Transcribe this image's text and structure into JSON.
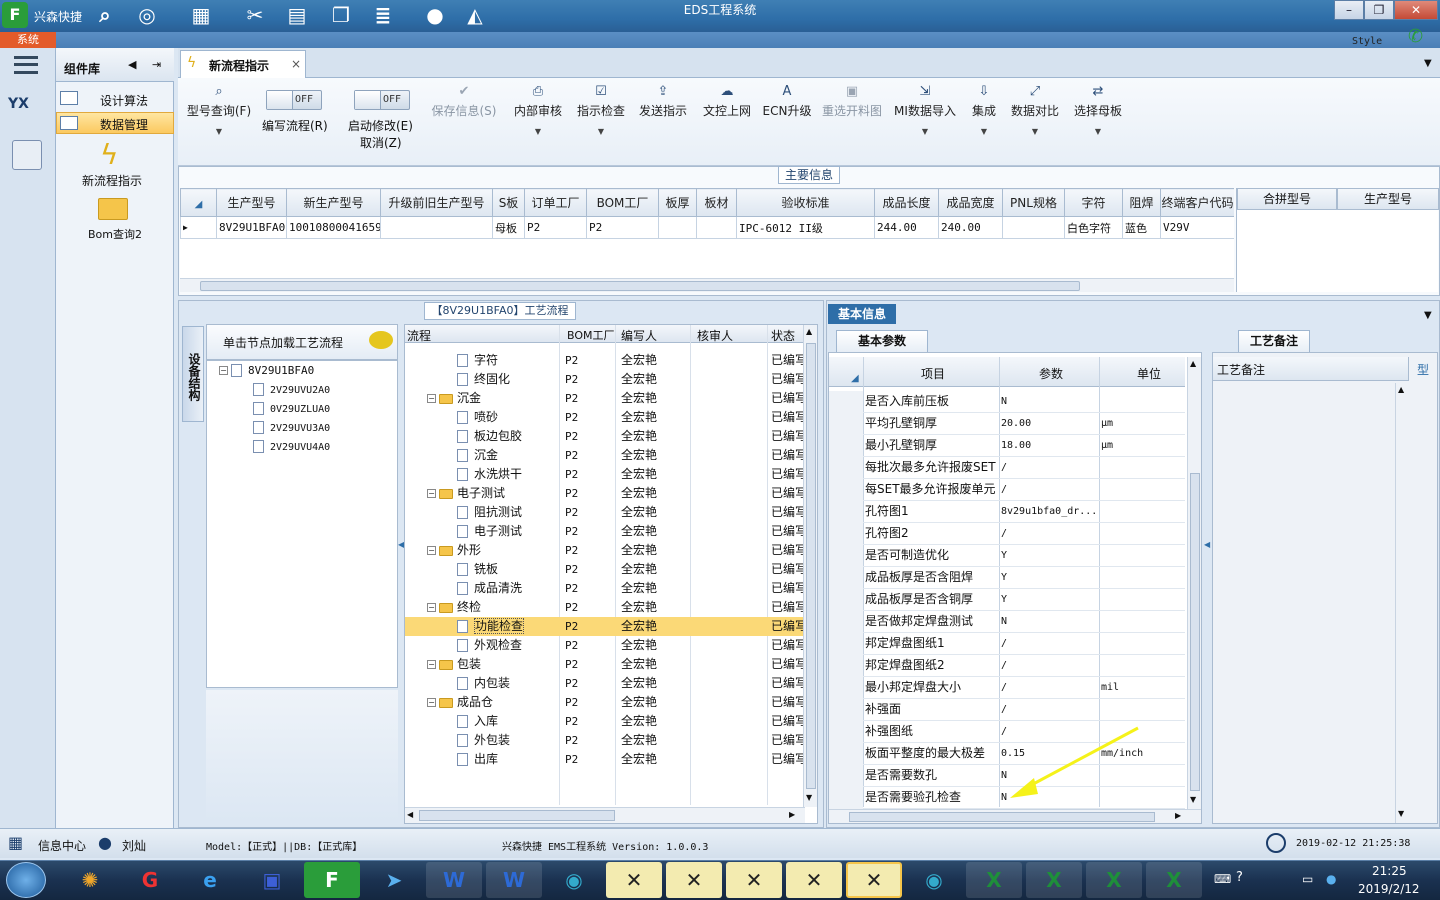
{
  "window": {
    "app_name": "兴森快捷",
    "title": "EDS工程系统",
    "menu_badge": "系统",
    "style_label": "Style",
    "min_label": "–",
    "max_label": "❐",
    "close_label": "✕"
  },
  "top_toolbar_icons": [
    "search-icon",
    "globe-icon",
    "table-icon",
    "scissors-icon",
    "film-icon",
    "clipboard-icon",
    "list-icon",
    "user-icon",
    "chart-icon"
  ],
  "left_nav": {
    "item1": "YX"
  },
  "component_panel": {
    "title": "组件库",
    "items": [
      {
        "label": "设计算法"
      },
      {
        "label": "数据管理"
      }
    ],
    "shortcuts": [
      {
        "label": "新流程指示"
      },
      {
        "label": "Bom查询2"
      }
    ]
  },
  "tab": {
    "label": "新流程指示",
    "close": "×"
  },
  "toolbar": {
    "buttons": [
      {
        "label": "型号查询(F)",
        "icon": "search-icon"
      },
      {
        "label": "保存信息(S)",
        "icon": "check-icon"
      },
      {
        "label": "内部审核",
        "icon": "print-icon"
      },
      {
        "label": "指示检查",
        "icon": "check-icon"
      },
      {
        "label": "发送指示",
        "icon": "upload-icon"
      },
      {
        "label": "文控上网",
        "icon": "cloud-upload-icon"
      },
      {
        "label": "ECN升级",
        "icon": "a-icon"
      },
      {
        "label": "重选开料图",
        "icon": "image-icon"
      },
      {
        "label": "MI数据导入",
        "icon": "import-icon"
      },
      {
        "label": "集成",
        "icon": "download-icon"
      },
      {
        "label": "数据对比",
        "icon": "compare-icon"
      },
      {
        "label": "选择母板",
        "icon": "shuffle-icon"
      }
    ],
    "toggle1": {
      "state": "OFF",
      "label": "编写流程(R)"
    },
    "toggle2": {
      "state": "OFF",
      "label": "启动修改(E)",
      "label2": "取消(Z)"
    }
  },
  "main_info": {
    "title": "主要信息",
    "columns": [
      "生产型号",
      "新生产型号",
      "升级前旧生产型号",
      "S板",
      "订单工厂",
      "BOM工厂",
      "板厚",
      "板材",
      "验收标准",
      "成品长度",
      "成品宽度",
      "PNL规格",
      "字符",
      "阻焊",
      "终端客户代码"
    ],
    "row": [
      "8V29U1BFA0",
      "10010800041659",
      "",
      "母板",
      "P2",
      "P2",
      "",
      "",
      "IPC-6012 II级",
      "244.00",
      "240.00",
      "",
      "白色字符",
      "蓝色",
      "V29V"
    ],
    "side_columns": [
      "合拼型号",
      "生产型号"
    ]
  },
  "process": {
    "title": "【8V29U1BFA0】工艺流程",
    "side_tab": "设备结构",
    "hint": "单击节点加载工艺流程",
    "tree": [
      {
        "label": "8V29U1BFA0",
        "level": 0
      },
      {
        "label": "2V29UVU2A0",
        "level": 1
      },
      {
        "label": "0V29UZLUA0",
        "level": 1
      },
      {
        "label": "2V29UVU3A0",
        "level": 1
      },
      {
        "label": "2V29UVU4A0",
        "level": 1
      }
    ],
    "columns": [
      "流程",
      "BOM工厂",
      "编写人",
      "核审人",
      "状态"
    ],
    "rows": [
      {
        "name": "字符",
        "type": "doc",
        "bom": "P2",
        "writer": "全宏艳",
        "status": "已编写"
      },
      {
        "name": "终固化",
        "type": "doc",
        "bom": "P2",
        "writer": "全宏艳",
        "status": "已编写"
      },
      {
        "name": "沉金",
        "type": "folder",
        "bom": "P2",
        "writer": "全宏艳",
        "status": "已编写"
      },
      {
        "name": "喷砂",
        "type": "doc",
        "bom": "P2",
        "writer": "全宏艳",
        "status": "已编写"
      },
      {
        "name": "板边包胶",
        "type": "doc",
        "bom": "P2",
        "writer": "全宏艳",
        "status": "已编写"
      },
      {
        "name": "沉金",
        "type": "doc",
        "bom": "P2",
        "writer": "全宏艳",
        "status": "已编写"
      },
      {
        "name": "水洗烘干",
        "type": "doc",
        "bom": "P2",
        "writer": "全宏艳",
        "status": "已编写"
      },
      {
        "name": "电子测试",
        "type": "folder",
        "bom": "P2",
        "writer": "全宏艳",
        "status": "已编写"
      },
      {
        "name": "阻抗测试",
        "type": "doc",
        "bom": "P2",
        "writer": "全宏艳",
        "status": "已编写"
      },
      {
        "name": "电子测试",
        "type": "doc",
        "bom": "P2",
        "writer": "全宏艳",
        "status": "已编写"
      },
      {
        "name": "外形",
        "type": "folder",
        "bom": "P2",
        "writer": "全宏艳",
        "status": "已编写"
      },
      {
        "name": "铣板",
        "type": "doc",
        "bom": "P2",
        "writer": "全宏艳",
        "status": "已编写"
      },
      {
        "name": "成品清洗",
        "type": "doc",
        "bom": "P2",
        "writer": "全宏艳",
        "status": "已编写"
      },
      {
        "name": "终检",
        "type": "folder",
        "bom": "P2",
        "writer": "全宏艳",
        "status": "已编写"
      },
      {
        "name": "功能检查",
        "type": "doc",
        "bom": "P2",
        "writer": "全宏艳",
        "status": "已编写",
        "selected": true
      },
      {
        "name": "外观检查",
        "type": "doc",
        "bom": "P2",
        "writer": "全宏艳",
        "status": "已编写"
      },
      {
        "name": "包装",
        "type": "folder",
        "bom": "P2",
        "writer": "全宏艳",
        "status": "已编写"
      },
      {
        "name": "内包装",
        "type": "doc",
        "bom": "P2",
        "writer": "全宏艳",
        "status": "已编写"
      },
      {
        "name": "成品仓",
        "type": "folder",
        "bom": "P2",
        "writer": "全宏艳",
        "status": "已编写"
      },
      {
        "name": "入库",
        "type": "doc",
        "bom": "P2",
        "writer": "全宏艳",
        "status": "已编写"
      },
      {
        "name": "外包装",
        "type": "doc",
        "bom": "P2",
        "writer": "全宏艳",
        "status": "已编写"
      },
      {
        "name": "出库",
        "type": "doc",
        "bom": "P2",
        "writer": "全宏艳",
        "status": "已编写"
      }
    ]
  },
  "basic_info": {
    "title": "基本信息",
    "subtab": "基本参数",
    "columns": [
      "项目",
      "参数",
      "单位"
    ],
    "rows": [
      {
        "item": "是否入库前压板",
        "param": "N",
        "unit": ""
      },
      {
        "item": "平均孔壁铜厚",
        "param": "20.00",
        "unit": "μm"
      },
      {
        "item": "最小孔壁铜厚",
        "param": "18.00",
        "unit": "μm"
      },
      {
        "item": "每批次最多允许报废SET",
        "param": "/",
        "unit": ""
      },
      {
        "item": "每SET最多允许报废单元",
        "param": "/",
        "unit": ""
      },
      {
        "item": "孔符图1",
        "param": "8v29u1bfa0_dr...",
        "unit": ""
      },
      {
        "item": "孔符图2",
        "param": "/",
        "unit": ""
      },
      {
        "item": "是否可制造优化",
        "param": "Y",
        "unit": ""
      },
      {
        "item": "成品板厚是否含阻焊",
        "param": "Y",
        "unit": ""
      },
      {
        "item": "成品板厚是否含铜厚",
        "param": "Y",
        "unit": ""
      },
      {
        "item": "是否做邦定焊盘测试",
        "param": "N",
        "unit": ""
      },
      {
        "item": "邦定焊盘图纸1",
        "param": "/",
        "unit": ""
      },
      {
        "item": "邦定焊盘图纸2",
        "param": "/",
        "unit": ""
      },
      {
        "item": "最小邦定焊盘大小",
        "param": "/",
        "unit": "mil"
      },
      {
        "item": "补强面",
        "param": "/",
        "unit": ""
      },
      {
        "item": "补强图纸",
        "param": "/",
        "unit": ""
      },
      {
        "item": "板面平整度的最大极差",
        "param": "0.15",
        "unit": "mm/inch"
      },
      {
        "item": "是否需要数孔",
        "param": "N",
        "unit": ""
      },
      {
        "item": "是否需要验孔检查",
        "param": "N",
        "unit": ""
      }
    ]
  },
  "process_notes": {
    "title": "工艺备注",
    "col1": "工艺备注",
    "col2": "型"
  },
  "status": {
    "info_center": "信息中心",
    "user": "刘灿",
    "model": "Model:【正式】||DB:【正式库】",
    "version": "兴森快捷 EMS工程系统 Version: 1.0.0.3",
    "datetime": "2019-02-12 21:25:38"
  },
  "taskbar": {
    "time": "21:25",
    "date": "2019/2/12"
  },
  "colors": {
    "accent": "#2e6ea8",
    "selected_row": "#fbd977",
    "badge": "#e35b2a",
    "arrow": "#f5f21a"
  }
}
